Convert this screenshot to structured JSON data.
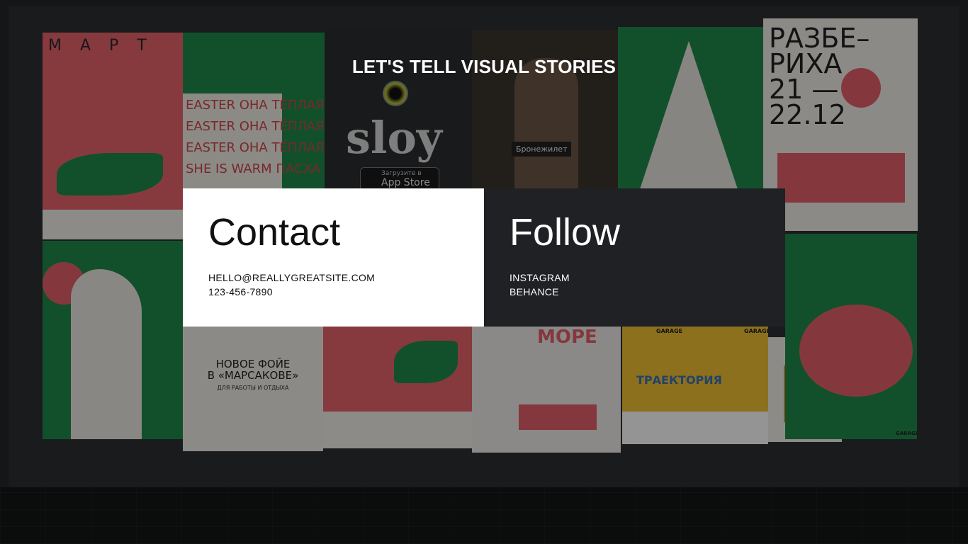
{
  "headline": "LET'S TELL VISUAL STORIES",
  "contact": {
    "title": "Contact",
    "email": "HELLO@REALLYGREATSITE.COM",
    "phone": "123-456-7890"
  },
  "follow": {
    "title": "Follow",
    "links": [
      "INSTAGRAM",
      "BEHANCE"
    ]
  },
  "background_posters": {
    "mapt": "МАРТ",
    "easter": [
      "EASTER ОНА ТЁПЛАЯ",
      "EASTER ОНА ТЁПЛАЯ",
      "EASTER ОНА ТЁПЛАЯ",
      "SHE IS WARM ПАСХА"
    ],
    "sloy": "sloy",
    "app_store_top": "Загрузите в",
    "app_store": "App Store",
    "bronezhilet": "Бронежилет",
    "razberikha": [
      "РАЗБЕ–",
      "РИХА",
      "21 —",
      "22.12"
    ],
    "novoe_foie": [
      "НОВОЕ ФОЙЕ",
      "В «МАРСАКОВЕ»",
      "ДЛЯ РАБОТЫ И ОТДЫХА"
    ],
    "more": "МОРЕ",
    "traektoria": "ТРАЕКТОРИЯ",
    "garage": "GARAGE"
  },
  "colors": {
    "panel_light": "#ffffff",
    "panel_dark": "#1f2124",
    "poster_red": "#e4616a",
    "poster_green": "#1f8a4c"
  }
}
